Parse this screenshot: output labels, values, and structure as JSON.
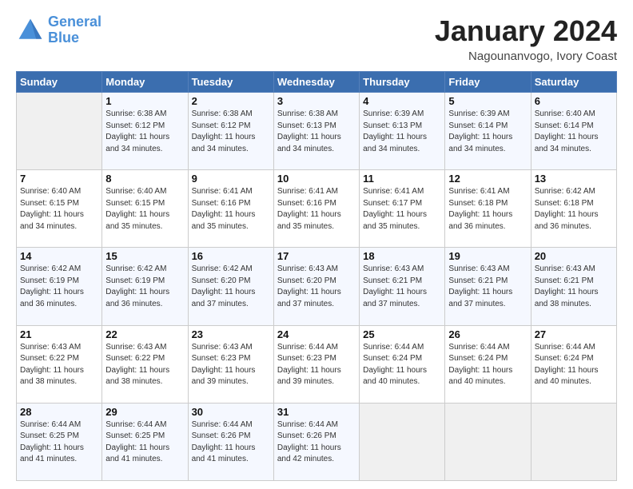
{
  "header": {
    "logo_line1": "General",
    "logo_line2": "Blue",
    "main_title": "January 2024",
    "subtitle": "Nagounanvogo, Ivory Coast"
  },
  "calendar": {
    "days_of_week": [
      "Sunday",
      "Monday",
      "Tuesday",
      "Wednesday",
      "Thursday",
      "Friday",
      "Saturday"
    ],
    "weeks": [
      [
        {
          "day": "",
          "info": ""
        },
        {
          "day": "1",
          "info": "Sunrise: 6:38 AM\nSunset: 6:12 PM\nDaylight: 11 hours\nand 34 minutes."
        },
        {
          "day": "2",
          "info": "Sunrise: 6:38 AM\nSunset: 6:12 PM\nDaylight: 11 hours\nand 34 minutes."
        },
        {
          "day": "3",
          "info": "Sunrise: 6:38 AM\nSunset: 6:13 PM\nDaylight: 11 hours\nand 34 minutes."
        },
        {
          "day": "4",
          "info": "Sunrise: 6:39 AM\nSunset: 6:13 PM\nDaylight: 11 hours\nand 34 minutes."
        },
        {
          "day": "5",
          "info": "Sunrise: 6:39 AM\nSunset: 6:14 PM\nDaylight: 11 hours\nand 34 minutes."
        },
        {
          "day": "6",
          "info": "Sunrise: 6:40 AM\nSunset: 6:14 PM\nDaylight: 11 hours\nand 34 minutes."
        }
      ],
      [
        {
          "day": "7",
          "info": "Sunrise: 6:40 AM\nSunset: 6:15 PM\nDaylight: 11 hours\nand 34 minutes."
        },
        {
          "day": "8",
          "info": "Sunrise: 6:40 AM\nSunset: 6:15 PM\nDaylight: 11 hours\nand 35 minutes."
        },
        {
          "day": "9",
          "info": "Sunrise: 6:41 AM\nSunset: 6:16 PM\nDaylight: 11 hours\nand 35 minutes."
        },
        {
          "day": "10",
          "info": "Sunrise: 6:41 AM\nSunset: 6:16 PM\nDaylight: 11 hours\nand 35 minutes."
        },
        {
          "day": "11",
          "info": "Sunrise: 6:41 AM\nSunset: 6:17 PM\nDaylight: 11 hours\nand 35 minutes."
        },
        {
          "day": "12",
          "info": "Sunrise: 6:41 AM\nSunset: 6:18 PM\nDaylight: 11 hours\nand 36 minutes."
        },
        {
          "day": "13",
          "info": "Sunrise: 6:42 AM\nSunset: 6:18 PM\nDaylight: 11 hours\nand 36 minutes."
        }
      ],
      [
        {
          "day": "14",
          "info": "Sunrise: 6:42 AM\nSunset: 6:19 PM\nDaylight: 11 hours\nand 36 minutes."
        },
        {
          "day": "15",
          "info": "Sunrise: 6:42 AM\nSunset: 6:19 PM\nDaylight: 11 hours\nand 36 minutes."
        },
        {
          "day": "16",
          "info": "Sunrise: 6:42 AM\nSunset: 6:20 PM\nDaylight: 11 hours\nand 37 minutes."
        },
        {
          "day": "17",
          "info": "Sunrise: 6:43 AM\nSunset: 6:20 PM\nDaylight: 11 hours\nand 37 minutes."
        },
        {
          "day": "18",
          "info": "Sunrise: 6:43 AM\nSunset: 6:21 PM\nDaylight: 11 hours\nand 37 minutes."
        },
        {
          "day": "19",
          "info": "Sunrise: 6:43 AM\nSunset: 6:21 PM\nDaylight: 11 hours\nand 37 minutes."
        },
        {
          "day": "20",
          "info": "Sunrise: 6:43 AM\nSunset: 6:21 PM\nDaylight: 11 hours\nand 38 minutes."
        }
      ],
      [
        {
          "day": "21",
          "info": "Sunrise: 6:43 AM\nSunset: 6:22 PM\nDaylight: 11 hours\nand 38 minutes."
        },
        {
          "day": "22",
          "info": "Sunrise: 6:43 AM\nSunset: 6:22 PM\nDaylight: 11 hours\nand 38 minutes."
        },
        {
          "day": "23",
          "info": "Sunrise: 6:43 AM\nSunset: 6:23 PM\nDaylight: 11 hours\nand 39 minutes."
        },
        {
          "day": "24",
          "info": "Sunrise: 6:44 AM\nSunset: 6:23 PM\nDaylight: 11 hours\nand 39 minutes."
        },
        {
          "day": "25",
          "info": "Sunrise: 6:44 AM\nSunset: 6:24 PM\nDaylight: 11 hours\nand 40 minutes."
        },
        {
          "day": "26",
          "info": "Sunrise: 6:44 AM\nSunset: 6:24 PM\nDaylight: 11 hours\nand 40 minutes."
        },
        {
          "day": "27",
          "info": "Sunrise: 6:44 AM\nSunset: 6:24 PM\nDaylight: 11 hours\nand 40 minutes."
        }
      ],
      [
        {
          "day": "28",
          "info": "Sunrise: 6:44 AM\nSunset: 6:25 PM\nDaylight: 11 hours\nand 41 minutes."
        },
        {
          "day": "29",
          "info": "Sunrise: 6:44 AM\nSunset: 6:25 PM\nDaylight: 11 hours\nand 41 minutes."
        },
        {
          "day": "30",
          "info": "Sunrise: 6:44 AM\nSunset: 6:26 PM\nDaylight: 11 hours\nand 41 minutes."
        },
        {
          "day": "31",
          "info": "Sunrise: 6:44 AM\nSunset: 6:26 PM\nDaylight: 11 hours\nand 42 minutes."
        },
        {
          "day": "",
          "info": ""
        },
        {
          "day": "",
          "info": ""
        },
        {
          "day": "",
          "info": ""
        }
      ]
    ]
  }
}
